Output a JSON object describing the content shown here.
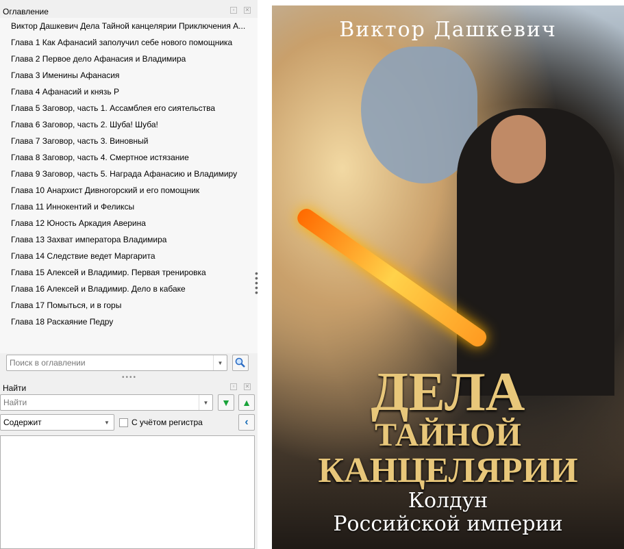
{
  "toc_panel": {
    "title": "Оглавление",
    "search_placeholder": "Поиск в оглавлении",
    "items": [
      "Виктор Дашкевич Дела Тайной канцелярии Приключения А...",
      "Глава 1 Как Афанасий заполучил себе нового помощника",
      "Глава 2 Первое дело Афанасия и Владимира",
      "Глава 3 Именины Афанасия",
      "Глава 4 Афанасий и князь Р",
      "Глава 5 Заговор, часть 1. Ассамблея его сиятельства",
      "Глава 6 Заговор, часть 2. Шуба! Шуба!",
      "Глава 7 Заговор, часть 3. Виновный",
      "Глава 8 Заговор, часть 4. Смертное истязание",
      "Глава 9 Заговор, часть 5. Награда Афанасию и Владимиру",
      "Глава 10 Анархист Дивногорский и его помощник",
      "Глава 11 Иннокентий и Феликсы",
      "Глава 12 Юность Аркадия Аверина",
      "Глава 13 Захват императора Владимира",
      "Глава 14 Следствие ведет Маргарита",
      "Глава 15 Алексей и Владимир. Первая тренировка",
      "Глава 16 Алексей и Владимир. Дело в кабаке",
      "Глава 17 Помыться, и в горы",
      "Глава 18 Раскаяние Педру"
    ]
  },
  "find_panel": {
    "title": "Найти",
    "find_placeholder": "Найти",
    "mode": "Содержит",
    "case_label": "С учётом регистра"
  },
  "cover": {
    "author": "Виктор Дашкевич",
    "title_line1": "ДЕЛА",
    "title_line2": "ТАЙНОЙ",
    "title_line3": "КАНЦЕЛЯРИИ",
    "subtitle_line1": "Колдун",
    "subtitle_line2": "Российской империи"
  }
}
